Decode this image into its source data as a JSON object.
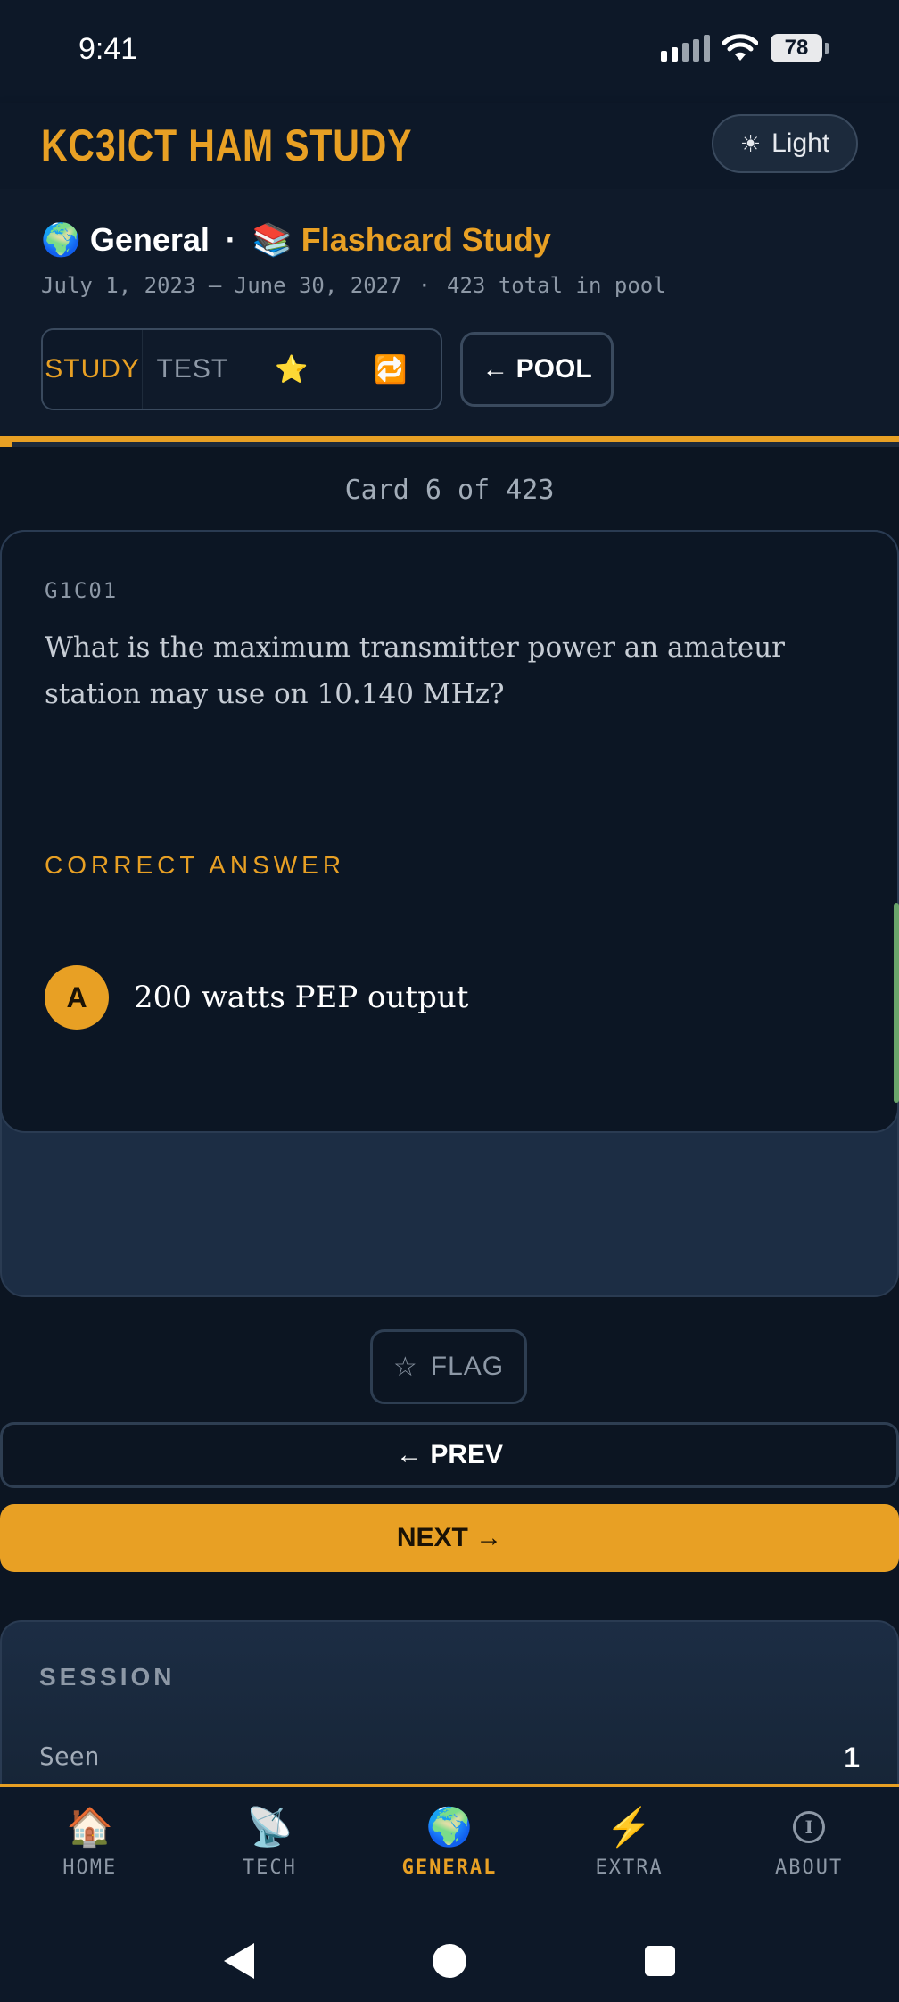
{
  "status_bar": {
    "time": "9:41",
    "battery": "78",
    "icons": [
      "signal-icon",
      "wifi-icon",
      "battery-icon"
    ]
  },
  "header": {
    "title": "KC3ICT HAM STUDY",
    "theme_button": {
      "icon": "sun-icon",
      "label": "Light"
    }
  },
  "breadcrumb": {
    "level_icon": "🌍",
    "level": "General",
    "separator": "·",
    "mode_icon": "📚",
    "mode": "Flashcard Study"
  },
  "pool_meta": {
    "dates": "July 1, 2023 – June 30, 2027",
    "separator": "·",
    "total": "423 total in pool"
  },
  "mode_tabs": [
    {
      "label": "STUDY",
      "active": true
    },
    {
      "label": "TEST",
      "active": false
    },
    {
      "label": "⭐",
      "icon": "star-icon",
      "active": false
    },
    {
      "label": "🔁",
      "icon": "repeat-icon",
      "active": false
    }
  ],
  "pool_button": "← POOL",
  "progress": {
    "current": 6,
    "total": 423
  },
  "card_counter": "Card 6 of 423",
  "card": {
    "id": "G1C01",
    "question": "What is the maximum transmitter power an amateur station may use on 10.140 MHz?",
    "answer_label": "CORRECT ANSWER",
    "answer_letter": "A",
    "answer_text": "200 watts PEP output"
  },
  "actions": {
    "flag": {
      "icon": "☆",
      "label": "FLAG"
    },
    "prev": "← PREV",
    "next": "NEXT →"
  },
  "session": {
    "title": "SESSION",
    "rows": [
      {
        "label": "Seen",
        "value": "1"
      }
    ]
  },
  "bottom_nav": [
    {
      "icon": "🏠",
      "label": "HOME",
      "active": false
    },
    {
      "icon": "📡",
      "label": "TECH",
      "active": false
    },
    {
      "icon": "🌍",
      "label": "GENERAL",
      "active": true
    },
    {
      "icon": "⚡",
      "label": "EXTRA",
      "active": false
    },
    {
      "icon": "ⓘ",
      "label": "ABOUT",
      "active": false
    }
  ],
  "colors": {
    "accent": "#e8a024",
    "background": "#0c1522",
    "card": "#0c1624",
    "muted": "#8d98a6"
  }
}
